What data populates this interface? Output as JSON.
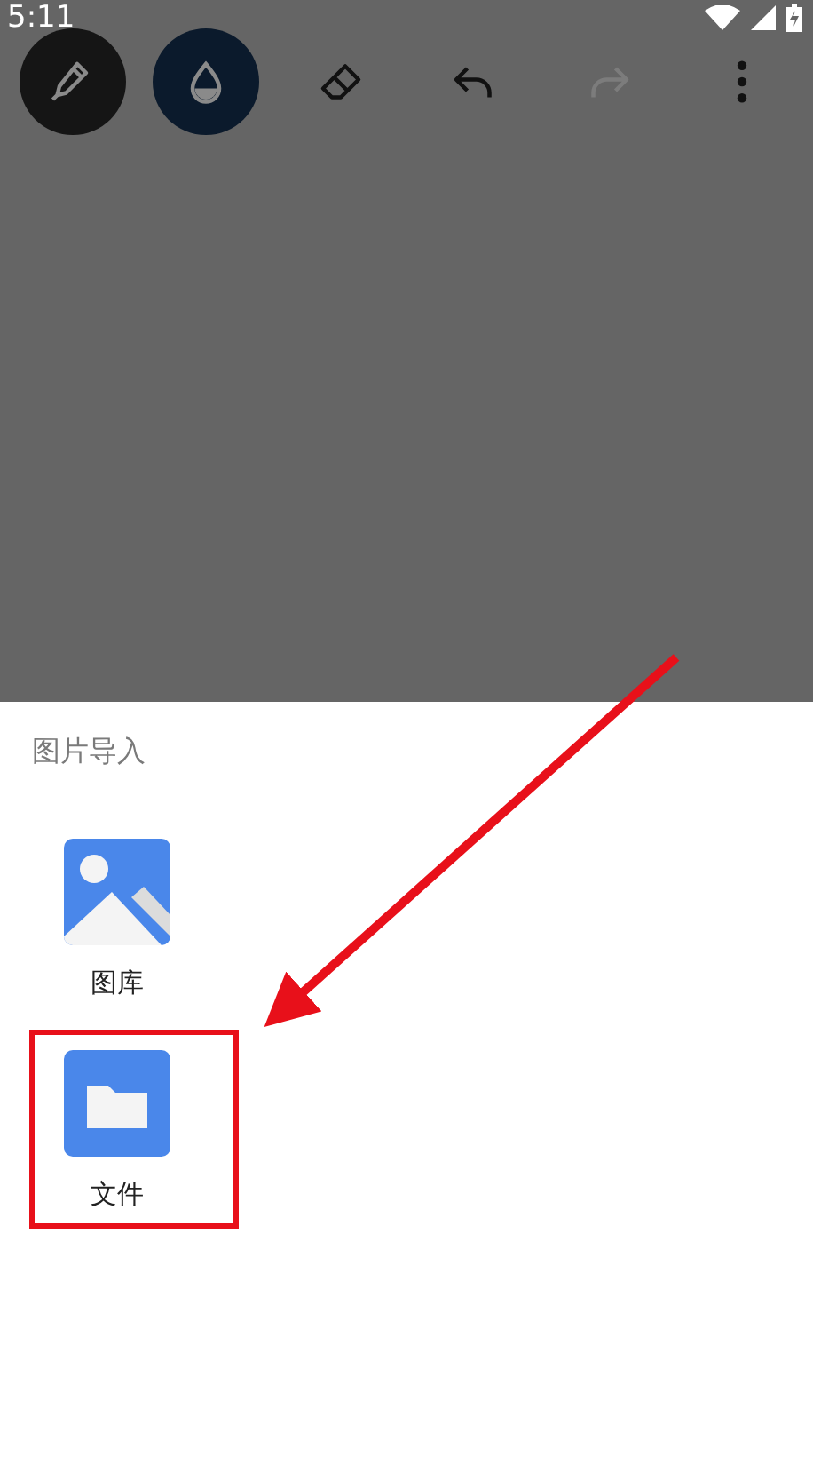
{
  "status_bar": {
    "time": "5:11"
  },
  "toolbar": [
    {
      "kind": "pen",
      "disabled": false
    },
    {
      "kind": "ink",
      "disabled": false
    },
    {
      "kind": "eraser",
      "disabled": false
    },
    {
      "kind": "undo",
      "disabled": false
    },
    {
      "kind": "redo",
      "disabled": true
    },
    {
      "kind": "more",
      "disabled": false
    }
  ],
  "sheet": {
    "title": "图片导入",
    "items": [
      {
        "kind": "gallery",
        "label": "图库",
        "highlighted": false
      },
      {
        "kind": "files",
        "label": "文件",
        "highlighted": true
      }
    ]
  }
}
